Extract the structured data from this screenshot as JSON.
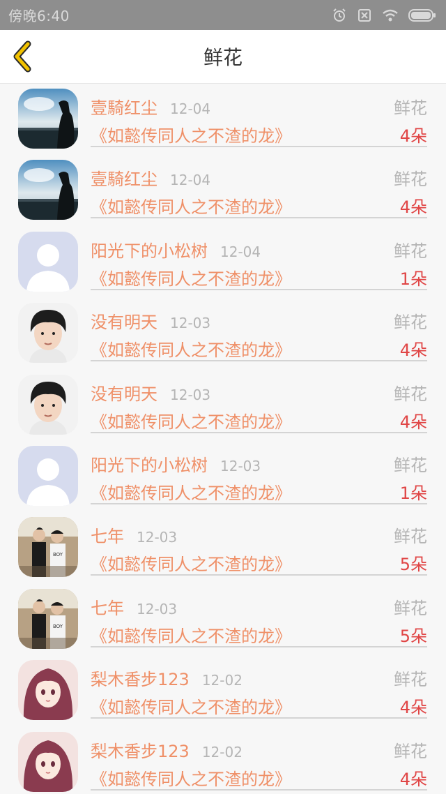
{
  "status_bar": {
    "time": "傍晚6:40",
    "icons": [
      "alarm-icon",
      "no-sim-icon",
      "wifi-icon",
      "battery-icon"
    ]
  },
  "nav": {
    "title": "鲜花",
    "back_icon": "chevron-left-icon"
  },
  "colors": {
    "accent": "#ef9068",
    "count": "#e04545",
    "muted": "#b5b5b5",
    "back_icon": "#e6b800"
  },
  "items": [
    {
      "name": "壹騎红尘",
      "date": "12-04",
      "label": "鲜花",
      "book": "《如懿传同人之不渣的龙》",
      "count": "4朵",
      "avatar": "silhouette-lake"
    },
    {
      "name": "壹騎红尘",
      "date": "12-04",
      "label": "鲜花",
      "book": "《如懿传同人之不渣的龙》",
      "count": "4朵",
      "avatar": "silhouette-lake"
    },
    {
      "name": "阳光下的小松树",
      "date": "12-04",
      "label": "鲜花",
      "book": "《如懿传同人之不渣的龙》",
      "count": "1朵",
      "avatar": "default-person"
    },
    {
      "name": "没有明天",
      "date": "12-03",
      "label": "鲜花",
      "book": "《如懿传同人之不渣的龙》",
      "count": "4朵",
      "avatar": "boy-portrait"
    },
    {
      "name": "没有明天",
      "date": "12-03",
      "label": "鲜花",
      "book": "《如懿传同人之不渣的龙》",
      "count": "4朵",
      "avatar": "boy-portrait"
    },
    {
      "name": "阳光下的小松树",
      "date": "12-03",
      "label": "鲜花",
      "book": "《如懿传同人之不渣的龙》",
      "count": "1朵",
      "avatar": "default-person"
    },
    {
      "name": "七年",
      "date": "12-03",
      "label": "鲜花",
      "book": "《如懿传同人之不渣的龙》",
      "count": "5朵",
      "avatar": "two-people"
    },
    {
      "name": "七年",
      "date": "12-03",
      "label": "鲜花",
      "book": "《如懿传同人之不渣的龙》",
      "count": "5朵",
      "avatar": "two-people"
    },
    {
      "name": "梨木香步123",
      "date": "12-02",
      "label": "鲜花",
      "book": "《如懿传同人之不渣的龙》",
      "count": "4朵",
      "avatar": "anime-girl"
    },
    {
      "name": "梨木香步123",
      "date": "12-02",
      "label": "鲜花",
      "book": "《如懿传同人之不渣的龙》",
      "count": "4朵",
      "avatar": "anime-girl"
    }
  ]
}
